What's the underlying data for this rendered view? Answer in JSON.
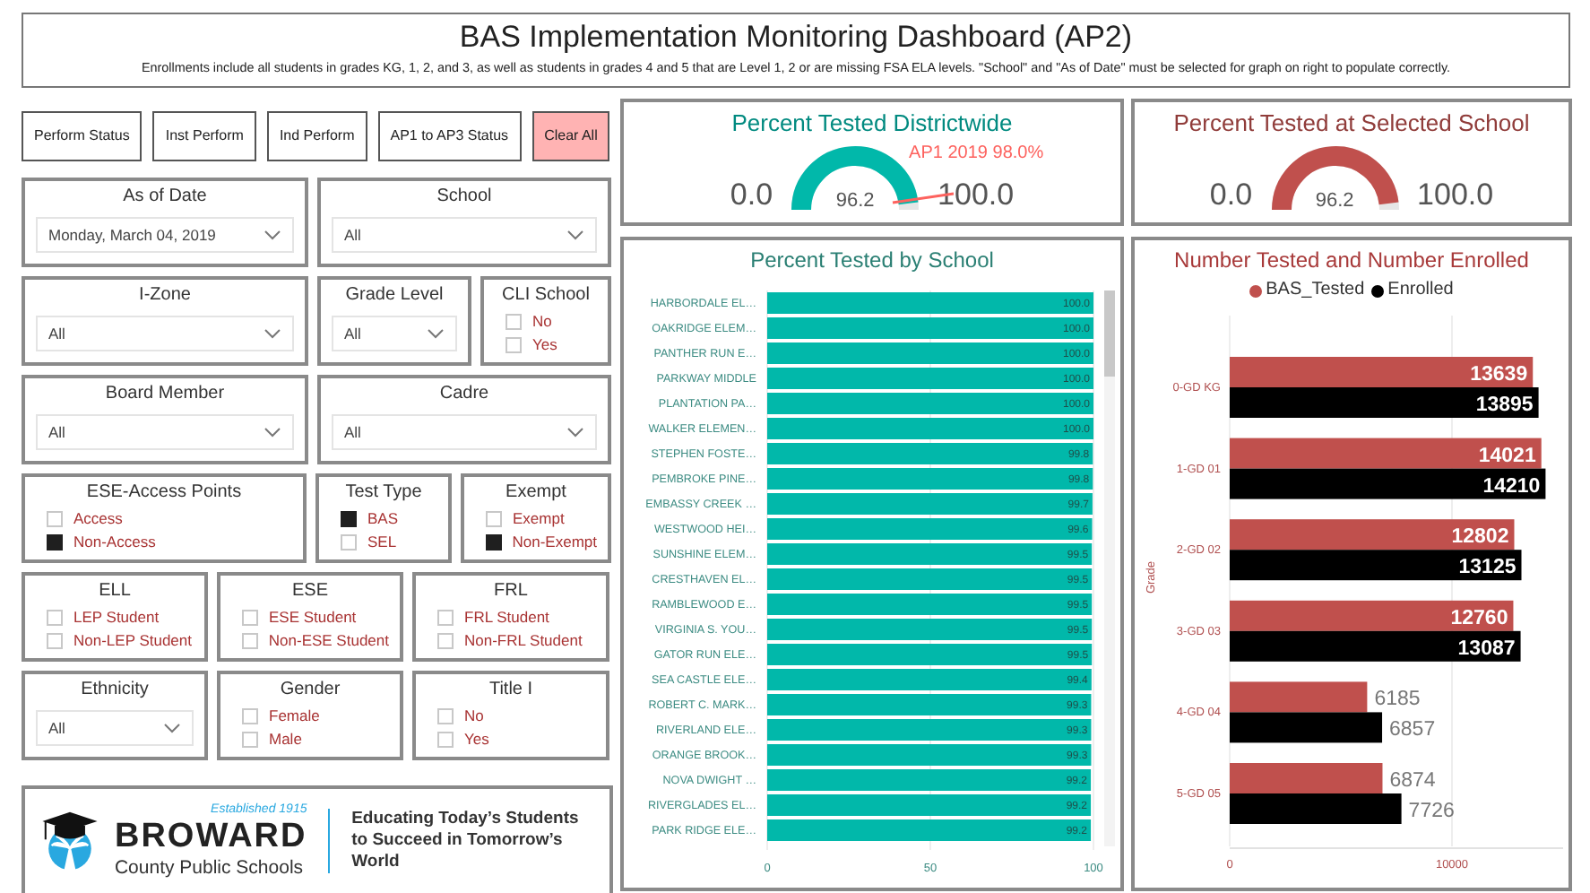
{
  "header": {
    "title": "BAS Implementation Monitoring Dashboard (AP2)",
    "note": "Enrollments include all students in grades KG, 1, 2, and 3, as well as students in grades 4 and 5 that are Level 1, 2 or are missing FSA ELA levels. \"School\" and \"As of Date\" must be selected for graph on right to populate correctly."
  },
  "buttons": [
    {
      "label": "Perform Status",
      "highlighted": false
    },
    {
      "label": "Inst Perform",
      "highlighted": false
    },
    {
      "label": "Ind Perform",
      "highlighted": false
    },
    {
      "label": "AP1 to AP3 Status",
      "highlighted": false
    },
    {
      "label": "Clear All",
      "highlighted": true
    }
  ],
  "filters": [
    [
      {
        "kind": "dropdown",
        "title": "As of Date",
        "value": "Monday, March 04, 2019"
      },
      {
        "kind": "dropdown",
        "title": "School",
        "value": "All"
      }
    ],
    [
      {
        "kind": "dropdown",
        "title": "I-Zone",
        "value": "All"
      },
      {
        "kind": "dropdown",
        "title": "Grade Level",
        "value": "All"
      },
      {
        "kind": "checklist",
        "title": "CLI School",
        "options": [
          {
            "label": "No",
            "checked": false
          },
          {
            "label": "Yes",
            "checked": false
          }
        ]
      }
    ],
    [
      {
        "kind": "dropdown",
        "title": "Board Member",
        "value": "All"
      },
      {
        "kind": "dropdown",
        "title": "Cadre",
        "value": "All"
      }
    ],
    [
      {
        "kind": "checklist",
        "title": "ESE-Access Points",
        "options": [
          {
            "label": "Access",
            "checked": false
          },
          {
            "label": "Non-Access",
            "checked": true
          }
        ]
      },
      {
        "kind": "checklist",
        "title": "Test Type",
        "options": [
          {
            "label": "BAS",
            "checked": true
          },
          {
            "label": "SEL",
            "checked": false
          }
        ]
      },
      {
        "kind": "checklist",
        "title": "Exempt",
        "options": [
          {
            "label": "Exempt",
            "checked": false
          },
          {
            "label": "Non-Exempt",
            "checked": true
          }
        ]
      }
    ],
    [
      {
        "kind": "checklist",
        "title": "ELL",
        "options": [
          {
            "label": "LEP Student",
            "checked": false
          },
          {
            "label": "Non-LEP Student",
            "checked": false
          }
        ]
      },
      {
        "kind": "checklist",
        "title": "ESE",
        "options": [
          {
            "label": "ESE Student",
            "checked": false
          },
          {
            "label": "Non-ESE Student",
            "checked": false
          }
        ]
      },
      {
        "kind": "checklist",
        "title": "FRL",
        "options": [
          {
            "label": "FRL Student",
            "checked": false
          },
          {
            "label": "Non-FRL Student",
            "checked": false
          }
        ]
      }
    ],
    [
      {
        "kind": "dropdown",
        "title": "Ethnicity",
        "value": "All"
      },
      {
        "kind": "checklist",
        "title": "Gender",
        "options": [
          {
            "label": "Female",
            "checked": false
          },
          {
            "label": "Male",
            "checked": false
          }
        ]
      },
      {
        "kind": "checklist",
        "title": "Title I",
        "options": [
          {
            "label": "No",
            "checked": false
          },
          {
            "label": "Yes",
            "checked": false
          }
        ]
      }
    ]
  ],
  "logo": {
    "established": "Established 1915",
    "name": "BROWARD",
    "subtitle": "County Public Schools",
    "tagline": "Educating Today’s Students to Succeed in Tomorrow’s World"
  },
  "gauges": [
    {
      "title": "Percent Tested Districtwide",
      "color": "#01b8aa",
      "min": "0.0",
      "max": "100.0",
      "value": "96.2",
      "target": "AP1 2019 98.0%"
    },
    {
      "title": "Percent Tested at Selected School",
      "color": "#c0504d",
      "min": "0.0",
      "max": "100.0",
      "value": "96.2"
    }
  ],
  "school_chart": {
    "title": "Percent Tested by School",
    "chart_data": {
      "type": "bar",
      "orientation": "horizontal",
      "categories": [
        "HARBORDALE EL…",
        "OAKRIDGE ELEM…",
        "PANTHER RUN E…",
        "PARKWAY MIDDLE",
        "PLANTATION PA…",
        "WALKER ELEMEN…",
        "STEPHEN FOSTE…",
        "PEMBROKE PINE…",
        "EMBASSY CREEK …",
        "WESTWOOD HEI…",
        "SUNSHINE ELEM…",
        "CRESTHAVEN EL…",
        "RAMBLEWOOD E…",
        "VIRGINIA S. YOU…",
        "GATOR RUN ELE…",
        "SEA CASTLE ELE…",
        "ROBERT C. MARK…",
        "RIVERLAND ELE…",
        "ORANGE BROOK…",
        "NOVA DWIGHT …",
        "RIVERGLADES EL…",
        "PARK RIDGE ELE…"
      ],
      "values": [
        100,
        100,
        100,
        100,
        100,
        100,
        99.8,
        99.8,
        99.7,
        99.6,
        99.5,
        99.5,
        99.5,
        99.5,
        99.5,
        99.4,
        99.3,
        99.3,
        99.3,
        99.2,
        99.2,
        99.2
      ],
      "value_labels": [
        "100.0",
        "100.0",
        "100.0",
        "100.0",
        "100.0",
        "100.0",
        "99.8",
        "99.8",
        "99.7",
        "99.6",
        "99.5",
        "99.5",
        "99.5",
        "99.5",
        "99.5",
        "99.4",
        "99.3",
        "99.3",
        "99.3",
        "99.2",
        "99.2",
        "99.2"
      ],
      "xlim": [
        0,
        100
      ],
      "xticks": [
        0,
        50,
        100
      ]
    }
  },
  "grade_chart": {
    "title": "Number Tested and Number Enrolled",
    "chart_data": {
      "type": "bar",
      "orientation": "horizontal",
      "ylabel": "Grade",
      "categories": [
        "0-GD KG",
        "1-GD 01",
        "2-GD 02",
        "3-GD 03",
        "4-GD 04",
        "5-GD 05"
      ],
      "series": [
        {
          "name": "BAS_Tested",
          "color": "#c0504d",
          "values": [
            13639,
            14021,
            12802,
            12760,
            6185,
            6874
          ]
        },
        {
          "name": "Enrolled",
          "color": "#000000",
          "values": [
            13895,
            14210,
            13125,
            13087,
            6857,
            7726
          ]
        }
      ],
      "data_labels": true,
      "xlim": [
        0,
        15000
      ],
      "xticks": [
        0,
        10000
      ]
    }
  }
}
